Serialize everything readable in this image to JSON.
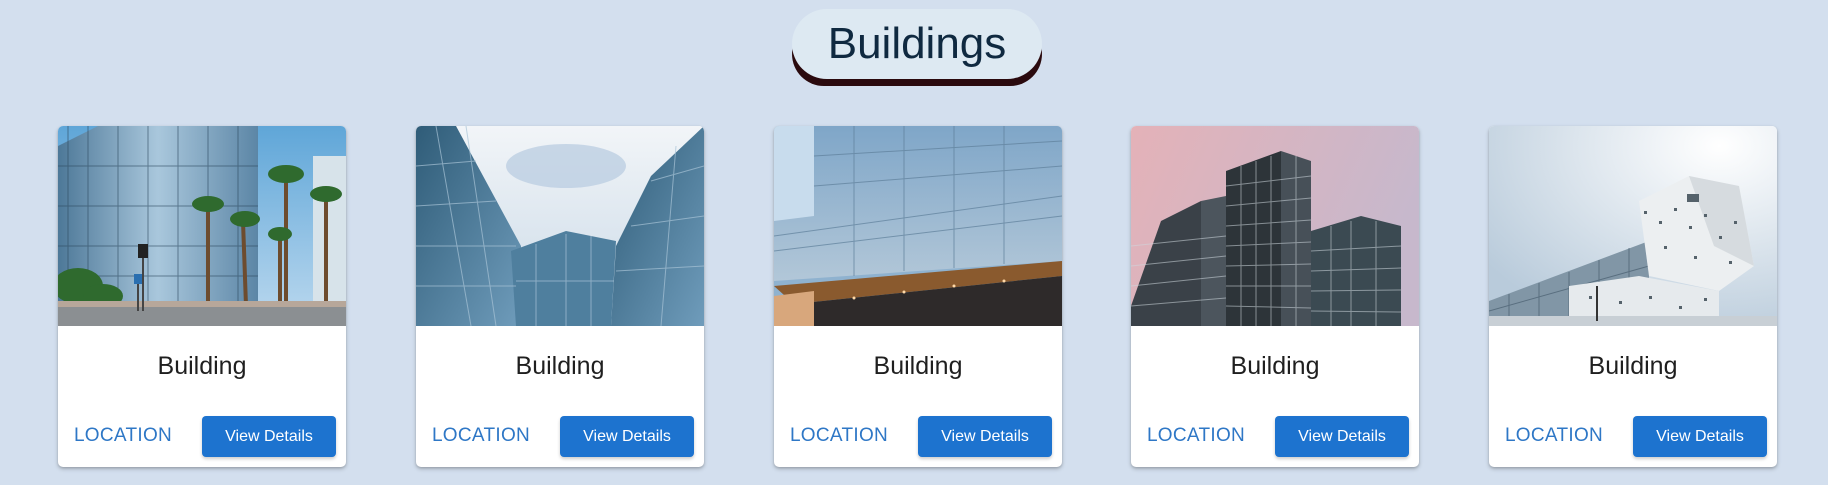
{
  "page": {
    "title": "Buildings"
  },
  "cards": [
    {
      "title": "Building",
      "location_label": "LOCATION",
      "details_label": "View Details",
      "image": "glass-office-with-palms"
    },
    {
      "title": "Building",
      "location_label": "LOCATION",
      "details_label": "View Details",
      "image": "curved-glass-facade"
    },
    {
      "title": "Building",
      "location_label": "LOCATION",
      "details_label": "View Details",
      "image": "modern-glass-highrise"
    },
    {
      "title": "Building",
      "location_label": "LOCATION",
      "details_label": "View Details",
      "image": "stepped-tower-pink-sky"
    },
    {
      "title": "Building",
      "location_label": "LOCATION",
      "details_label": "View Details",
      "image": "white-perforated-building"
    }
  ]
}
